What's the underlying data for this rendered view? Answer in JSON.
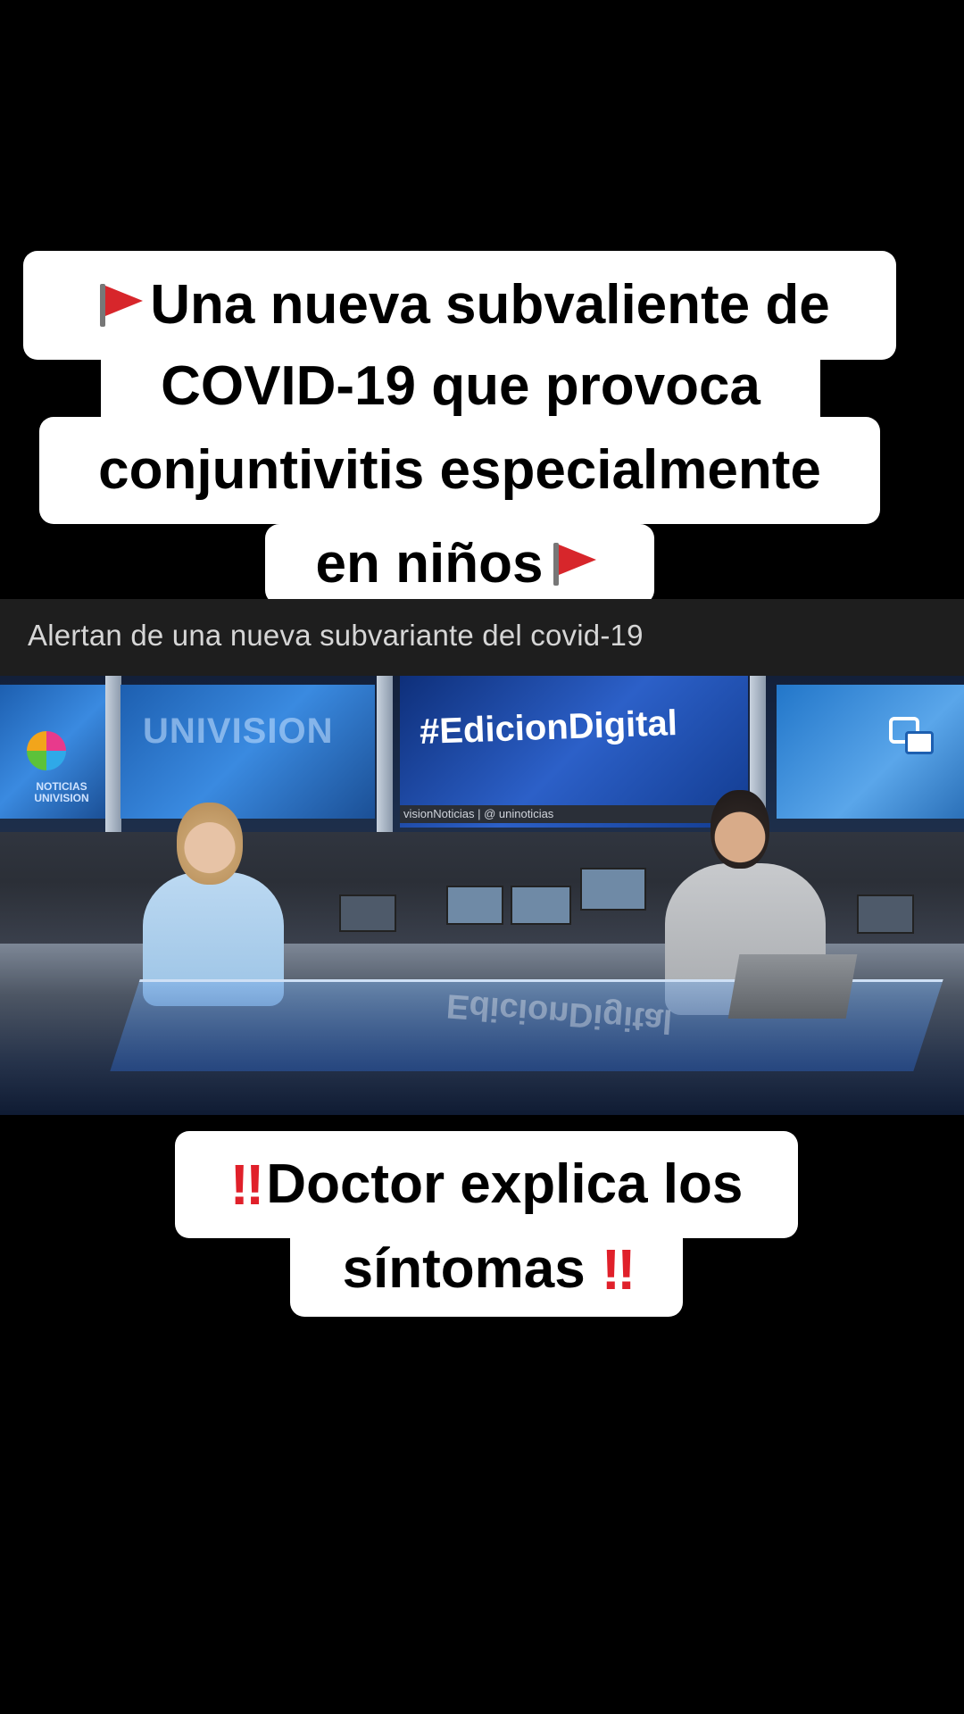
{
  "top_caption": {
    "line1": "Una nueva subvaliente de",
    "line2": "COVID-19 que provoca",
    "line3": "conjuntivitis especialmente",
    "line4": "en niños",
    "flag_icon": "red-flag-icon"
  },
  "video": {
    "header_title": "Alertan de una nueva subvariante del covid-19",
    "wall_logo_text": "NOTICIAS UNIVISION",
    "wall_brand": "UNIVISION",
    "hashtag": "#EdicionDigital",
    "ticker": "visionNoticias  |  @ uninoticias",
    "desk_reflection": "EdicionDigital",
    "pip_icon": "picture-in-picture-icon"
  },
  "bottom_caption": {
    "line1": "Doctor explica los",
    "line2": "síntomas",
    "emphasis_icon": "double-exclamation-icon",
    "emphasis_glyph": "‼"
  },
  "colors": {
    "background": "#000000",
    "caption_bg": "#ffffff",
    "caption_text": "#000000",
    "flag_red": "#d7262b",
    "exclamation_red": "#e0202a",
    "video_header_bg": "#1e1e1e"
  }
}
